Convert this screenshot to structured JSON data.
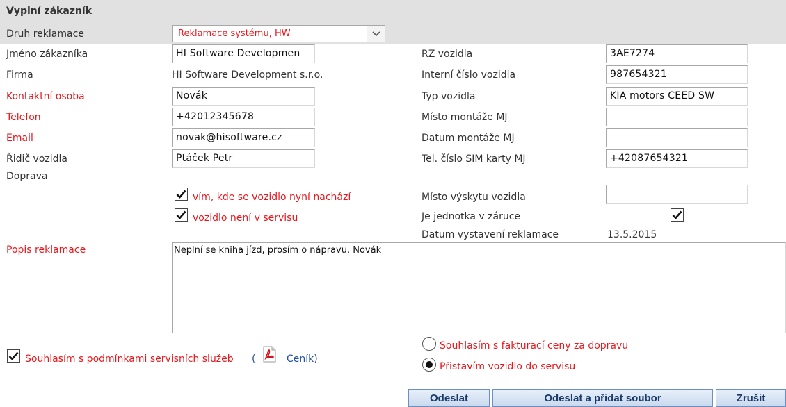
{
  "form": {
    "section_title": "Vyplní zákazník",
    "druh_label": "Druh reklamace",
    "druh_value": "Reklamace systému, HW",
    "left": [
      {
        "key": "jmeno",
        "label": "Jméno zákazníka",
        "value": "HI Software Developmen",
        "red": false
      },
      {
        "key": "firma",
        "label": "Firma",
        "value": "HI Software Development s.r.o.",
        "red": false
      },
      {
        "key": "kontakt",
        "label": "Kontaktní osoba",
        "value": "Novák",
        "red": true
      },
      {
        "key": "telefon",
        "label": "Telefon",
        "value": "+42012345678",
        "red": true
      },
      {
        "key": "email",
        "label": "Email",
        "value": "novak@hisoftware.cz",
        "red": true
      },
      {
        "key": "ridic",
        "label": "Řidič vozidla",
        "value": "Ptáček Petr",
        "red": false
      }
    ],
    "doprava_label": "Doprava",
    "right": [
      {
        "label": "RZ vozidla",
        "value": "3AE7274"
      },
      {
        "label": "Interní číslo vozidla",
        "value": "987654321"
      },
      {
        "label": "Typ vozidla",
        "value": "KIA motors CEED SW"
      },
      {
        "label": "Místo montáže MJ",
        "value": ""
      },
      {
        "label": "Datum montáže MJ",
        "value": ""
      },
      {
        "label": "Tel. číslo SIM karty MJ",
        "value": "+42087654321"
      }
    ],
    "check_vim": {
      "label": "vím, kde se vozidlo nyní nachází",
      "checked": true
    },
    "check_servis": {
      "label": "vozidlo není v servisu",
      "checked": true
    },
    "misto_vyskytu_label": "Místo výskytu vozidla",
    "misto_vyskytu_value": "",
    "zaruka_label": "Je jednotka v záruce",
    "zaruka_checked": true,
    "datum_vystaveni_label": "Datum vystavení reklamace",
    "datum_vystaveni_value": "13.5.2015",
    "popis_label": "Popis reklamace",
    "popis_value": "Neplní se kniha jízd, prosím o nápravu. Novák",
    "souhlas_label": "Souhlasím s podmínkami servisních služeb",
    "paren_open": "(",
    "cenik_label": "Ceník",
    "paren_close": ")",
    "radio_faktura": {
      "label": "Souhlasím s fakturací ceny za dopravu",
      "selected": false
    },
    "radio_pristavim": {
      "label": "Přistavím vozidlo do servisu",
      "selected": true
    }
  },
  "buttons": {
    "odeslat": "Odeslat",
    "odeslat_soubor": "Odeslat a přidat soubor",
    "zrusit": "Zrušit"
  },
  "colors": {
    "required_label": "#e8171c",
    "header_band": "#e1e1e1",
    "link": "#1f4f9e"
  }
}
